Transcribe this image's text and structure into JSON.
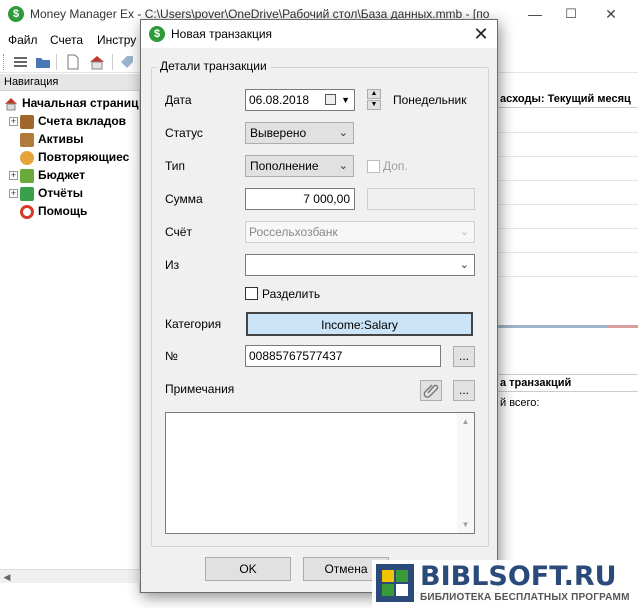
{
  "main_window": {
    "title": "Money Manager Ex - C:\\Users\\pover\\OneDrive\\Рабочий стол\\База данных.mmb - [по",
    "menu": [
      "Файл",
      "Счета",
      "Инстру"
    ],
    "controls": {
      "minimize": "—",
      "maximize": "☐",
      "close": "✕"
    }
  },
  "navigation": {
    "header": "Навигация",
    "items": [
      {
        "label": "Начальная страниц",
        "icon": "home-icon",
        "expandable": false
      },
      {
        "label": "Счета вкладов",
        "icon": "treasure-chest-icon",
        "expandable": true
      },
      {
        "label": "Активы",
        "icon": "briefcase-icon",
        "expandable": false
      },
      {
        "label": "Повторяющиес",
        "icon": "recurring-icon",
        "expandable": false
      },
      {
        "label": "Бюджет",
        "icon": "budget-icon",
        "expandable": true
      },
      {
        "label": "Отчёты",
        "icon": "reports-icon",
        "expandable": true
      },
      {
        "label": "Помощь",
        "icon": "lifebuoy-icon",
        "expandable": false
      }
    ]
  },
  "right_panel": {
    "header1": "асходы: Текущий месяц",
    "header2": "а транзакций",
    "total": "й всего:"
  },
  "dialog": {
    "title": "Новая транзакция",
    "group_title": "Детали транзакции",
    "date": {
      "label": "Дата",
      "value": "06.08.2018",
      "weekday": "Понедельник"
    },
    "status": {
      "label": "Статус",
      "value": "Выверено"
    },
    "type": {
      "label": "Тип",
      "value": "Пополнение",
      "advanced_label": "Доп."
    },
    "amount": {
      "label": "Сумма",
      "value": "7 000,00",
      "advanced_value": ""
    },
    "account": {
      "label": "Счёт",
      "value": "Россельхозбанк"
    },
    "from": {
      "label": "Из",
      "value": ""
    },
    "split": {
      "label": "Разделить",
      "checked": false
    },
    "category": {
      "label": "Категория",
      "value": "Income:Salary"
    },
    "number": {
      "label": "№",
      "value": "00885767577437",
      "button": "..."
    },
    "notes": {
      "label": "Примечания",
      "value": "",
      "button": "..."
    },
    "buttons": {
      "ok": "OK",
      "cancel": "Отмена"
    }
  },
  "watermark": {
    "title": "BIBLSOFT.RU",
    "subtitle": "БИБЛИОТЕКА БЕСПЛАТНЫХ ПРОГРАММ"
  },
  "colors": {
    "app_green": "#2e9a3a",
    "category_button": "#cce4f7",
    "watermark_blue": "#2a4a7a"
  }
}
